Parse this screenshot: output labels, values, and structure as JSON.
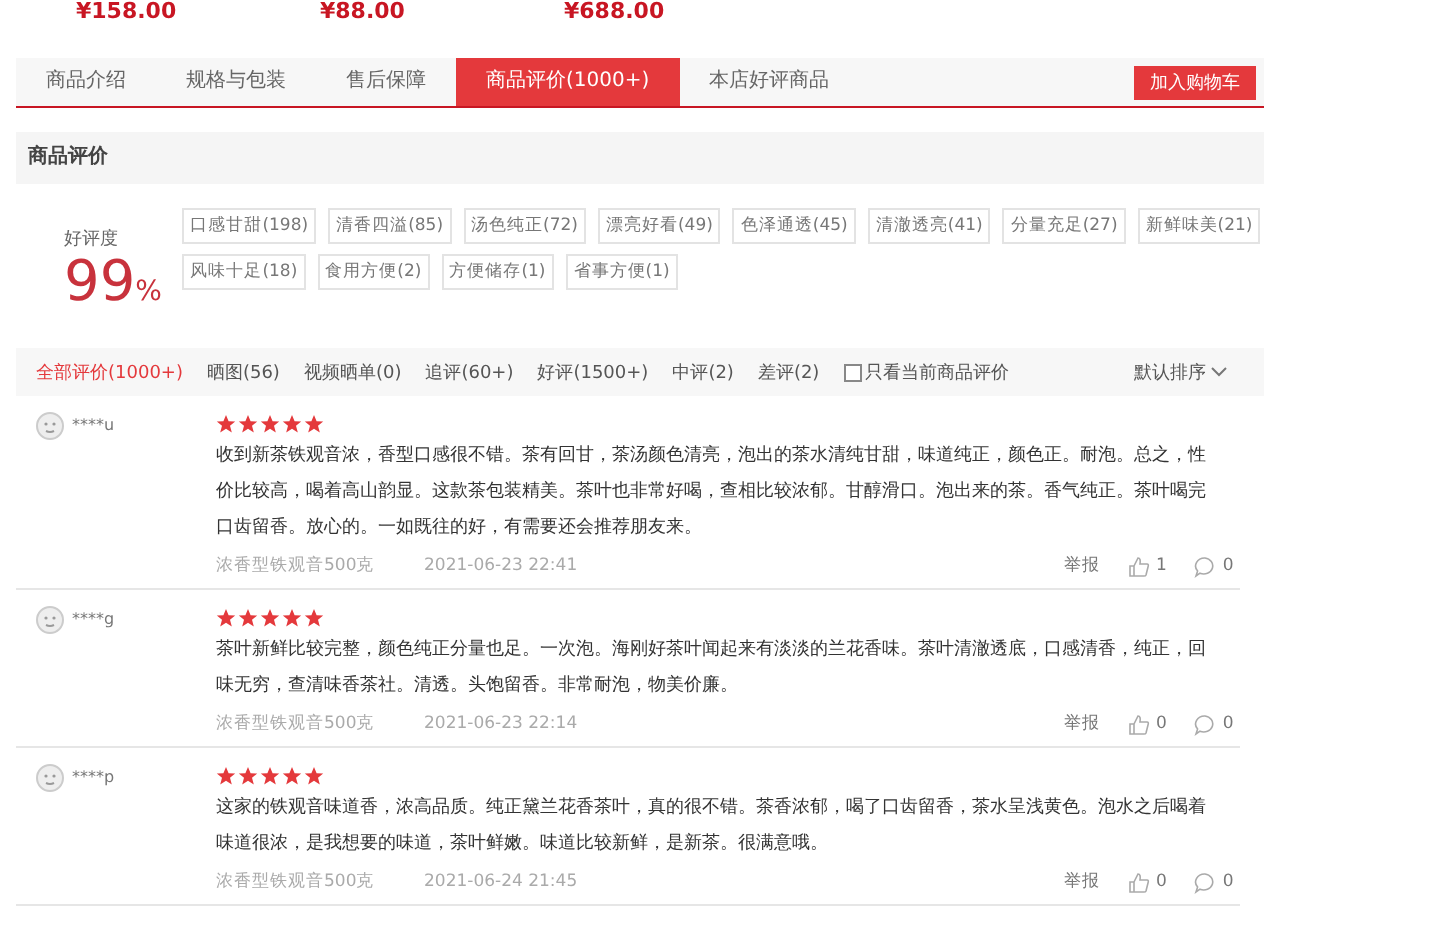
{
  "top_prices": [
    "¥158.00",
    "¥88.00",
    "¥688.00"
  ],
  "tabs": [
    {
      "label": "商品介绍",
      "selected": false
    },
    {
      "label": "规格与包装",
      "selected": false
    },
    {
      "label": "售后保障",
      "selected": false
    },
    {
      "label": "商品评价(1000+)",
      "selected": true
    },
    {
      "label": "本店好评商品",
      "selected": false
    }
  ],
  "cart_button": "加入购物车",
  "section_title": "商品评价",
  "rating": {
    "label": "好评度",
    "value": "99",
    "unit": "%"
  },
  "tags": [
    "口感甘甜(198)",
    "清香四溢(85)",
    "汤色纯正(72)",
    "漂亮好看(49)",
    "色泽通透(45)",
    "清澈透亮(41)",
    "分量充足(27)",
    "新鲜味美(21)",
    "风味十足(18)",
    "食用方便(2)",
    "方便储存(1)",
    "省事方便(1)"
  ],
  "filters": [
    {
      "label": "全部评价(1000+)",
      "selected": true
    },
    {
      "label": "晒图(56)",
      "selected": false
    },
    {
      "label": "视频晒单(0)",
      "selected": false
    },
    {
      "label": "追评(60+)",
      "selected": false
    },
    {
      "label": "好评(1500+)",
      "selected": false
    },
    {
      "label": "中评(2)",
      "selected": false
    },
    {
      "label": "差评(2)",
      "selected": false
    }
  ],
  "current_only": {
    "label": "只看当前商品评价",
    "checked": false
  },
  "sort": "默认排序",
  "reviews": [
    {
      "user": "****u",
      "stars": 5,
      "text": "收到新茶铁观音浓，香型口感很不错。茶有回甘，茶汤颜色清亮，泡出的茶水清纯甘甜，味道纯正，颜色正。耐泡。总之，性价比较高，喝着高山韵显。这款茶包装精美。茶叶也非常好喝，查相比较浓郁。甘醇滑口。泡出来的茶。香气纯正。茶叶喝完口齿留香。放心的。一如既往的好，有需要还会推荐朋友来。",
      "product": "浓香型铁观音500克",
      "date": "2021-06-23 22:41",
      "report": "举报",
      "likes": "1",
      "comments": "0"
    },
    {
      "user": "****g",
      "stars": 5,
      "text": "茶叶新鲜比较完整，颜色纯正分量也足。一次泡。海刚好茶叶闻起来有淡淡的兰花香味。茶叶清澈透底，口感清香，纯正，回味无穷，查清味香茶社。清透。头饱留香。非常耐泡，物美价廉。",
      "product": "浓香型铁观音500克",
      "date": "2021-06-23 22:14",
      "report": "举报",
      "likes": "0",
      "comments": "0"
    },
    {
      "user": "****p",
      "stars": 5,
      "text": "这家的铁观音味道香，浓高品质。纯正黛兰花香茶叶，真的很不错。茶香浓郁，喝了口齿留香，茶水呈浅黄色。泡水之后喝着味道很浓，是我想要的味道，茶叶鲜嫩。味道比较新鲜，是新茶。很满意哦。",
      "product": "浓香型铁观音500克",
      "date": "2021-06-24 21:45",
      "report": "举报",
      "likes": "0",
      "comments": "0"
    }
  ]
}
